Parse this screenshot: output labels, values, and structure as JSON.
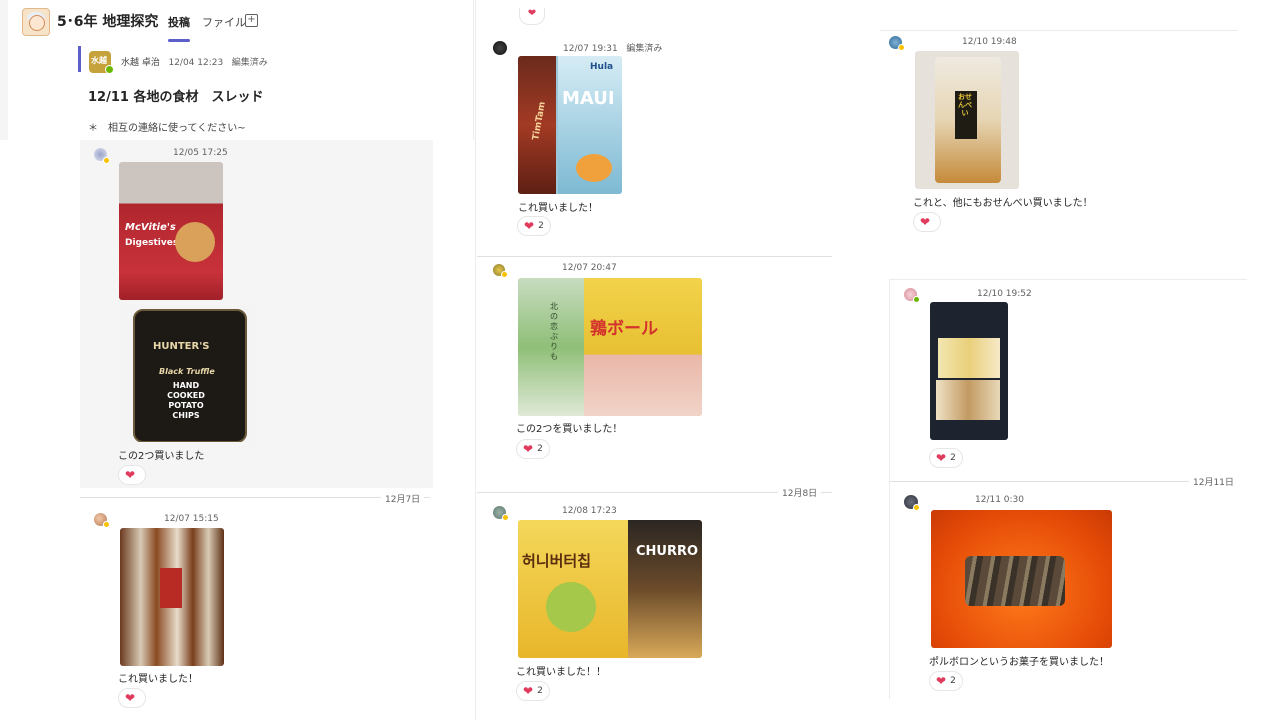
{
  "header": {
    "team_title": "5･6年 地理探究",
    "tabs": [
      "投稿",
      "ファイル"
    ],
    "add_tab_glyph": "+"
  },
  "thread": {
    "author": "水越 卓治",
    "author_badge": "水越",
    "time": "12/04 12:23",
    "edited": "編集済み",
    "title": "12/11 各地の食材　スレッド",
    "body": "＊　相互の連絡に使ってください~"
  },
  "posts": [
    {
      "time": "12/05 17:25",
      "text": "この2つ買いました",
      "reaction_count": ""
    },
    {
      "time": "12/07 15:15",
      "text": "これ買いました！",
      "reaction_count": ""
    },
    {
      "time": "12/07 19:31",
      "edited": "編集済み",
      "text": "これ買いました！",
      "reaction_count": "2"
    },
    {
      "time": "12/07 20:47",
      "text": "この2つを買いました！",
      "reaction_count": "2"
    },
    {
      "time": "12/08 17:23",
      "text": "これ買いました！！",
      "reaction_count": "2"
    },
    {
      "time": "12/10 19:48",
      "text": "これと、他にもおせんべい買いました！",
      "reaction_count": ""
    },
    {
      "time": "12/10 19:52",
      "text": "",
      "reaction_count": "2"
    },
    {
      "time": "12/11 0:30",
      "text": "ポルボロンというお菓子を買いました！",
      "reaction_count": "2"
    }
  ],
  "dividers": {
    "dec7": "12月7日",
    "dec8": "12月8日",
    "dec11": "12月11日"
  },
  "image_text": {
    "mcvities": "McVitie's",
    "digestives": "Digestives",
    "hunters": "HUNTER'S",
    "hunters_sub": "Black Truffle",
    "chips": "HAND COOKED POTATO CHIPS",
    "maui": "MAUI",
    "timtam": "TimTam",
    "hula": "Hula",
    "kita": "北の恋ぶりも",
    "uzura": "鶉ボール",
    "honey": "허니버터칩",
    "churro": "CHURRO",
    "senbei": "おせんべい"
  },
  "colors": {
    "accent": "#5b5fc7",
    "heart": "#e03a5c",
    "presence_green": "#6bb700",
    "presence_yellow": "#f8c200"
  }
}
